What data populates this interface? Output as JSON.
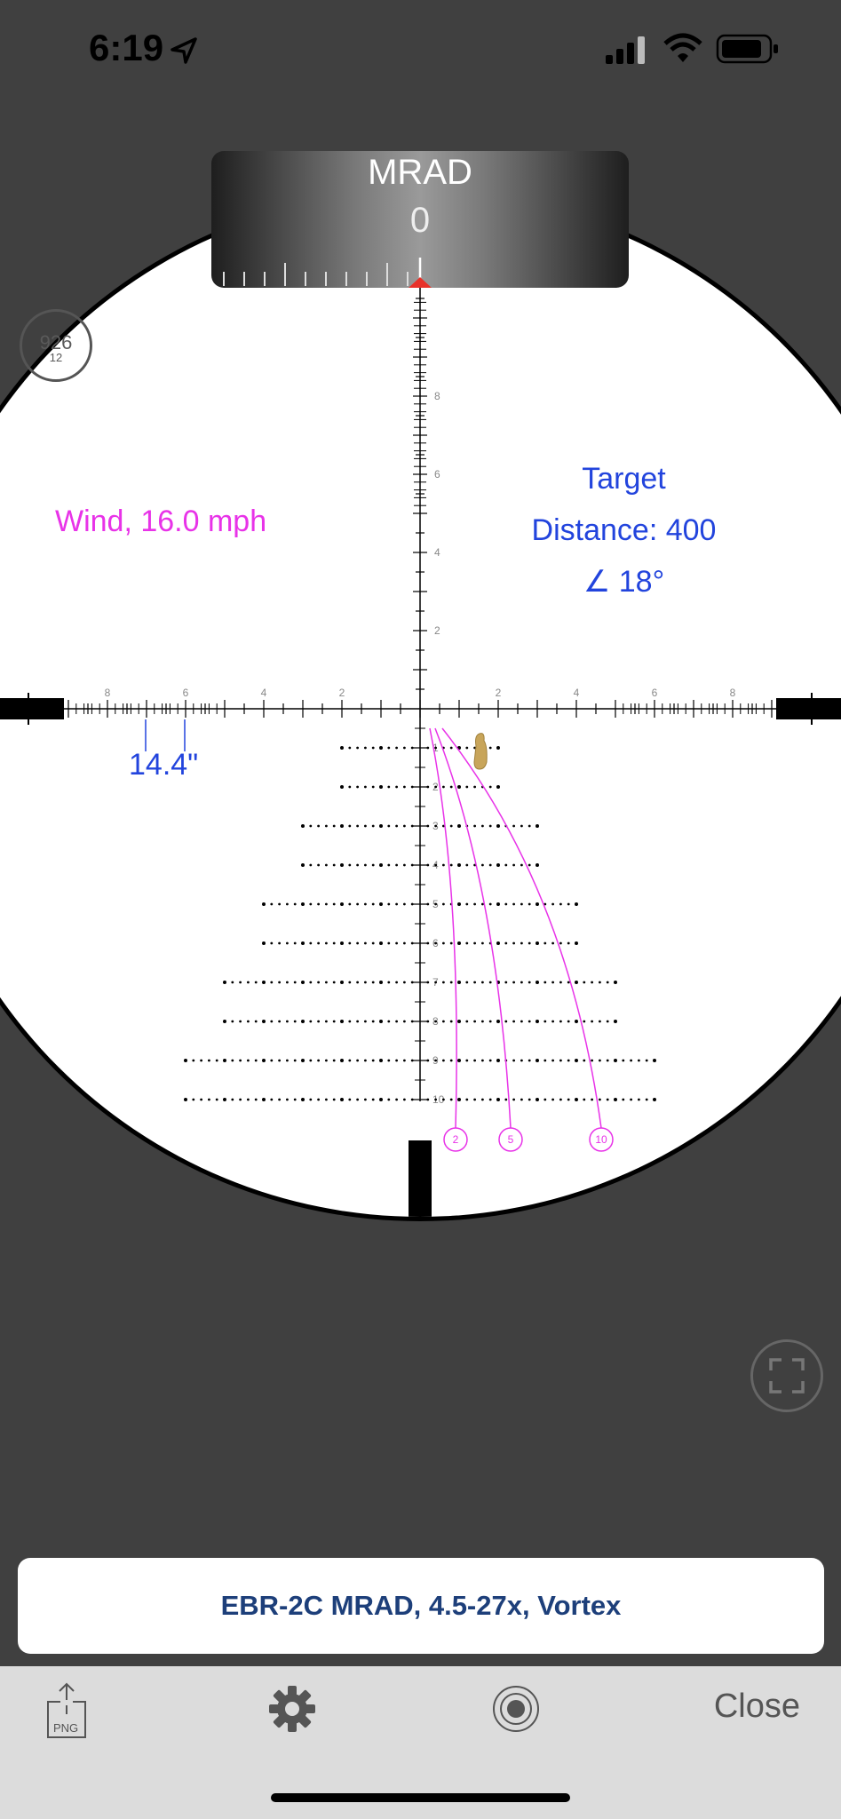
{
  "status_bar": {
    "time": "6:19"
  },
  "turret": {
    "unit": "MRAD",
    "value": "0"
  },
  "mag_badge": {
    "value": "926",
    "sub": "12"
  },
  "wind": {
    "label": "Wind, 16.0 mph"
  },
  "target": {
    "title": "Target",
    "distance": "Distance: 400",
    "angle": "∠ 18°"
  },
  "holdover": {
    "label": "14.4\""
  },
  "reticle": {
    "h_tick_labels": [
      "8",
      "6",
      "4",
      "2",
      "2",
      "4",
      "6",
      "8"
    ],
    "v_tick_labels_up": [
      "8",
      "6",
      "4",
      "2"
    ],
    "v_tick_labels_down": [
      "1",
      "2",
      "3",
      "4",
      "5",
      "6",
      "7",
      "8",
      "9",
      "10"
    ],
    "wind_curves": [
      "2",
      "5",
      "10"
    ]
  },
  "scope_name": "EBR-2C MRAD, 4.5-27x, Vortex",
  "toolbar": {
    "export_label": "PNG",
    "close_label": "Close"
  },
  "colors": {
    "wind": "#e833e8",
    "target": "#2244dd",
    "banner_text": "#1d3f7a"
  }
}
